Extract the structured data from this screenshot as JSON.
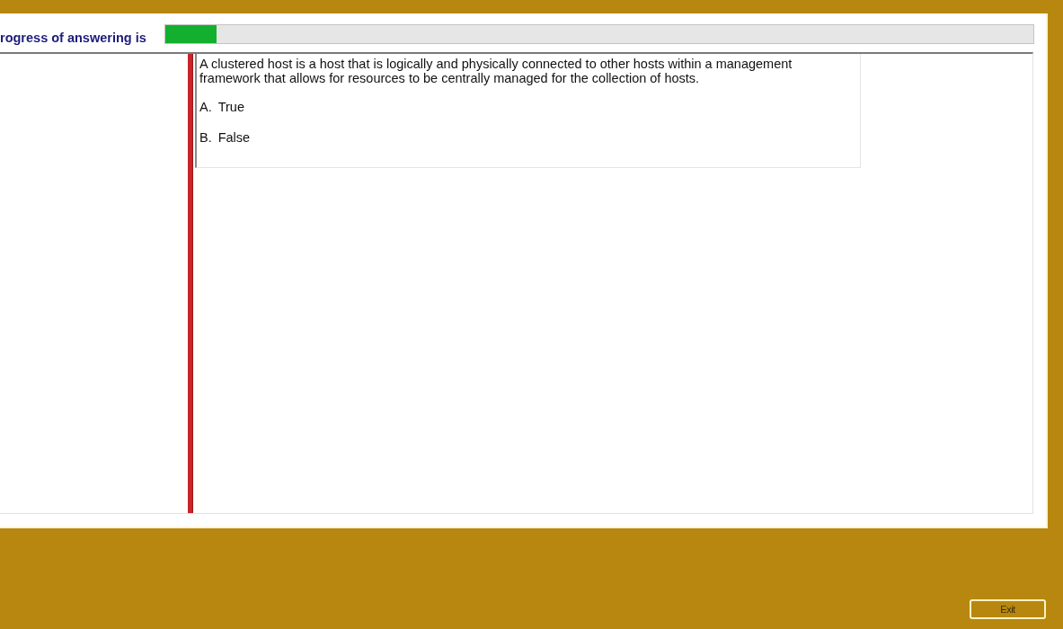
{
  "progress": {
    "label": "rogress of answering is",
    "level": 0.059
  },
  "question": {
    "text": "A clustered host is a host that is logically and physically connected to other hosts within a management framework that allows for resources to be centrally managed for the collection of hosts.",
    "options": [
      {
        "letter": "A.",
        "text": "True"
      },
      {
        "letter": "B.",
        "text": "False"
      }
    ]
  },
  "buttons": [
    {
      "label": "Exit"
    }
  ]
}
